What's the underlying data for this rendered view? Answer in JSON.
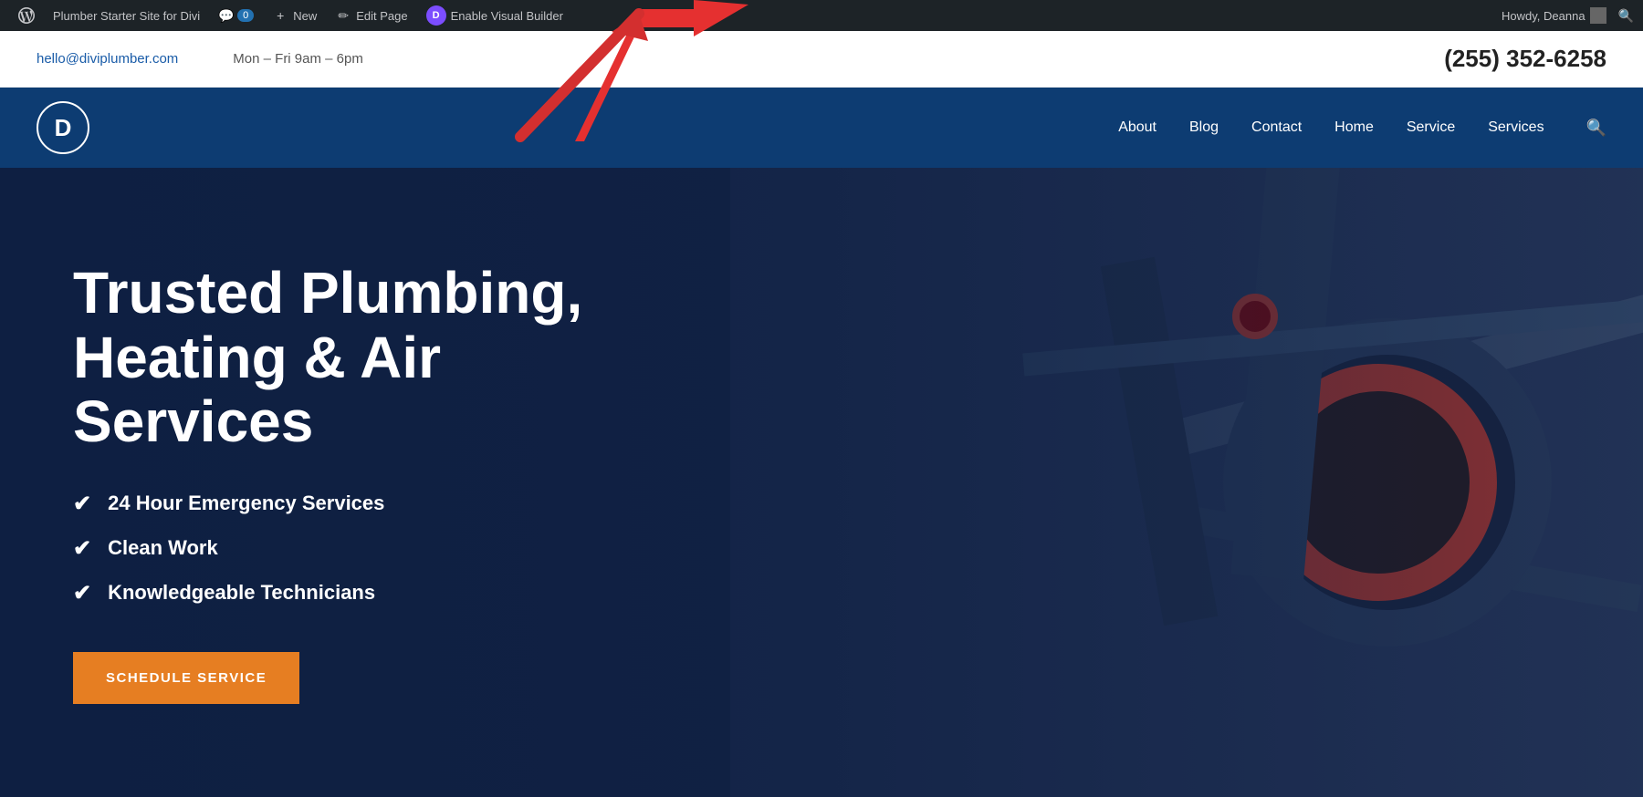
{
  "adminBar": {
    "siteName": "Plumber Starter Site for Divi",
    "commentCount": "0",
    "newLabel": "New",
    "editPageLabel": "Edit Page",
    "enableVisualBuilder": "Enable Visual Builder",
    "howdy": "Howdy, Deanna",
    "wpIconLabel": "WordPress",
    "diviIconLetter": "D"
  },
  "topBar": {
    "email": "hello@diviplumber.com",
    "hours": "Mon – Fri 9am – 6pm",
    "phone": "(255) 352-6258"
  },
  "nav": {
    "logoLetter": "D",
    "links": [
      "About",
      "Blog",
      "Contact",
      "Home",
      "Service",
      "Services"
    ],
    "searchIcon": "🔍"
  },
  "hero": {
    "title": "Trusted Plumbing, Heating & Air Services",
    "checklist": [
      "24 Hour Emergency Services",
      "Clean Work",
      "Knowledgeable Technicians"
    ],
    "ctaButton": "SCHEDULE SERVICE"
  }
}
